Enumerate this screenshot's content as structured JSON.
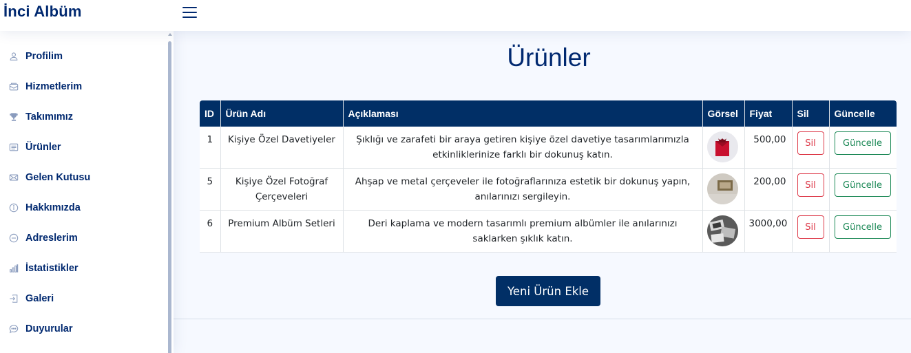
{
  "app": {
    "title": "İnci Albüm"
  },
  "sidebar": {
    "items": [
      {
        "label": "Profilim",
        "icon": "person-icon"
      },
      {
        "label": "Hizmetlerim",
        "icon": "envelope-open-icon"
      },
      {
        "label": "Takımımız",
        "icon": "trophy-icon"
      },
      {
        "label": "Ürünler",
        "icon": "list-card-icon"
      },
      {
        "label": "Gelen Kutusu",
        "icon": "envelope-icon"
      },
      {
        "label": "Hakkımızda",
        "icon": "info-circle-icon"
      },
      {
        "label": "Adreslerim",
        "icon": "dash-circle-icon"
      },
      {
        "label": "İstatistikler",
        "icon": "bar-chart-icon"
      },
      {
        "label": "Galeri",
        "icon": "box-arrow-in-right-icon"
      },
      {
        "label": "Duyurular",
        "icon": "chat-dots-icon"
      }
    ]
  },
  "main": {
    "title": "Ürünler",
    "table": {
      "headers": [
        "ID",
        "Ürün Adı",
        "Açıklaması",
        "Görsel",
        "Fiyat",
        "Sil",
        "Güncelle"
      ],
      "rows": [
        {
          "id": "1",
          "name": "Kişiye Özel Davetiyeler",
          "description": "Şıklığı ve zarafeti bir araya getiren kişiye özel davetiye tasarımlarımızla etkinliklerinize farklı bir dokunuş katın.",
          "price": "500,00",
          "delete_label": "Sil",
          "update_label": "Güncelle"
        },
        {
          "id": "5",
          "name": "Kişiye Özel Fotoğraf Çerçeveleri",
          "description": "Ahşap ve metal çerçeveler ile fotoğraflarınıza estetik bir dokunuş yapın, anılarınızı sergileyin.",
          "price": "200,00",
          "delete_label": "Sil",
          "update_label": "Güncelle"
        },
        {
          "id": "6",
          "name": "Premium Albüm Setleri",
          "description": "Deri kaplama ve modern tasarımlı premium albümler ile anılarınızı saklarken şıklık katın.",
          "price": "3000,00",
          "delete_label": "Sil",
          "update_label": "Güncelle"
        }
      ]
    },
    "add_button": "Yeni Ürün Ekle"
  },
  "colors": {
    "brand": "#012970",
    "table_header": "#012f66",
    "danger": "#dc3545",
    "success": "#198754"
  }
}
